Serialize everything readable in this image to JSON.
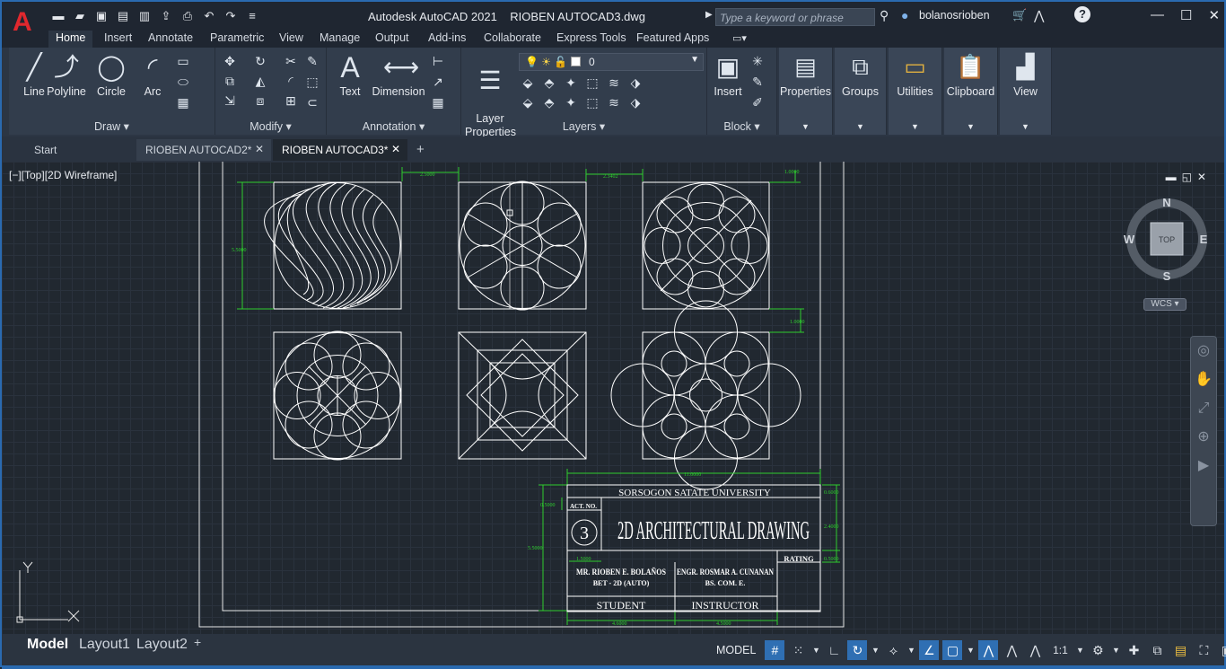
{
  "titlebar": {
    "app_title": "Autodesk AutoCAD 2021",
    "file_title": "RIOBEN AUTOCAD3.dwg",
    "search_placeholder": "Type a keyword or phrase",
    "user": "bolanosrioben",
    "logo": "A"
  },
  "ribbon_tabs": [
    "Home",
    "Insert",
    "Annotate",
    "Parametric",
    "View",
    "Manage",
    "Output",
    "Add-ins",
    "Collaborate",
    "Express Tools",
    "Featured Apps"
  ],
  "ribbon": {
    "draw": {
      "title": "Draw",
      "line": "Line",
      "polyline": "Polyline",
      "circle": "Circle",
      "arc": "Arc"
    },
    "modify": {
      "title": "Modify"
    },
    "annotation": {
      "title": "Annotation",
      "text": "Text",
      "dimension": "Dimension"
    },
    "layers": {
      "title": "Layers",
      "layer_properties": "Layer\nProperties",
      "current_layer": "0"
    },
    "block": {
      "title": "Block",
      "insert": "Insert"
    },
    "properties": "Properties",
    "groups": "Groups",
    "utilities": "Utilities",
    "clipboard": "Clipboard",
    "view": "View"
  },
  "file_tabs": {
    "start": "Start",
    "tab1": "RIOBEN  AUTOCAD2*",
    "tab2": "RIOBEN AUTOCAD3*"
  },
  "viewport": {
    "label": "[−][Top][2D Wireframe]",
    "wcs": "WCS",
    "viewcube_top": "TOP",
    "compass": {
      "n": "N",
      "s": "S",
      "e": "E",
      "w": "W"
    },
    "ucs_x": "X",
    "ucs_y": "Y"
  },
  "drawing": {
    "dims": {
      "d1": "2.5000",
      "d2": "2.3402",
      "d3": "1.0000",
      "d4": "5.5000",
      "d5": "1.0000",
      "d6": "11.0000",
      "d7": "0.6000",
      "d8": "0.5000",
      "d9": "2.4000",
      "d10": "5.5000",
      "d11": "1.5000",
      "d12": "0.5000",
      "d13": "4.6000",
      "d14": "4.5000"
    },
    "titleblock": {
      "university": "SORSOGON SATATE UNIVERSITY",
      "act_no": "ACT. NO.",
      "act_num": "3",
      "title": "2D ARCHITECTURAL DRAWING",
      "rating": "RATING",
      "student_name": "MR. RIOBEN E. BOLAÑOS",
      "student_course": "BET - 2D (AUTO)",
      "instructor_name": "ENGR. ROSMAR A. CUNANAN",
      "instructor_course": "BS. COM. E.",
      "student_label": "STUDENT",
      "instructor_label": "INSTRUCTOR"
    }
  },
  "layout_tabs": [
    "Model",
    "Layout1",
    "Layout2"
  ],
  "status": {
    "model": "MODEL",
    "scale": "1:1"
  }
}
